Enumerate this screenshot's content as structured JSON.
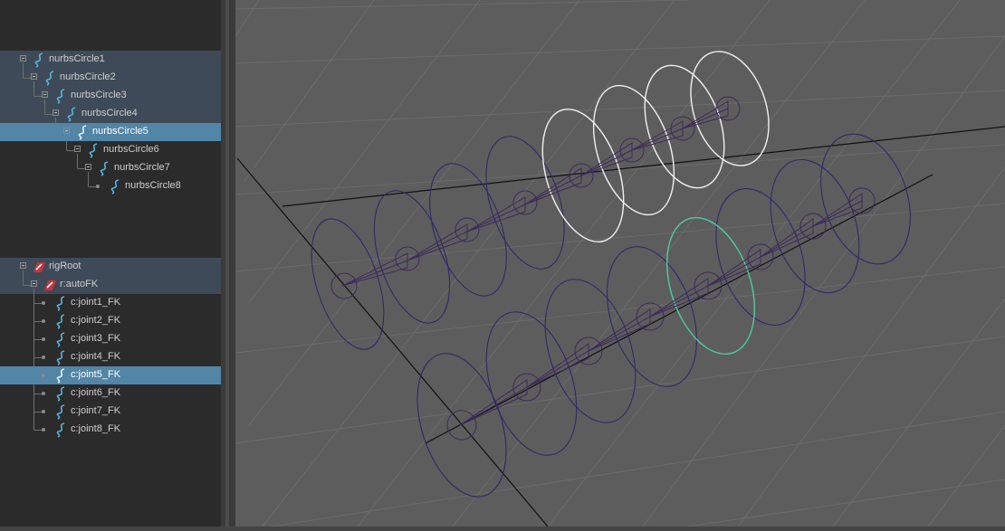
{
  "outliner": {
    "curves": [
      {
        "label": "nurbsCircle1",
        "selected": false
      },
      {
        "label": "nurbsCircle2",
        "selected": false
      },
      {
        "label": "nurbsCircle3",
        "selected": false
      },
      {
        "label": "nurbsCircle4",
        "selected": false
      },
      {
        "label": "nurbsCircle5",
        "selected": true
      },
      {
        "label": "nurbsCircle6",
        "selected": false
      },
      {
        "label": "nurbsCircle7",
        "selected": false
      },
      {
        "label": "nurbsCircle8",
        "selected": false
      }
    ],
    "rig": {
      "root": "rigRoot",
      "auto": "r:autoFK",
      "joints": [
        {
          "label": "c:joint1_FK",
          "selected": false
        },
        {
          "label": "c:joint2_FK",
          "selected": false
        },
        {
          "label": "c:joint3_FK",
          "selected": false
        },
        {
          "label": "c:joint4_FK",
          "selected": false
        },
        {
          "label": "c:joint5_FK",
          "selected": true
        },
        {
          "label": "c:joint6_FK",
          "selected": false
        },
        {
          "label": "c:joint7_FK",
          "selected": false
        },
        {
          "label": "c:joint8_FK",
          "selected": false
        }
      ]
    }
  },
  "colors": {
    "panel_bg": "#2b2b2b",
    "group_bg": "#3e4a57",
    "selection_bg": "#5285a6",
    "viewport_bg": "#5d5d5d",
    "grid": "#6b6b6b",
    "curve_icon": "#58b4e0",
    "rig_icon": "#c9323a",
    "control_circle": "#2e2a66",
    "selected_circle": "#f0f0f0",
    "lead_circle": "#52c9a1",
    "joint_lines": "#3c2a5a"
  },
  "icons": {
    "curve": "nurbs-curve-icon",
    "rig": "transform-icon",
    "expand": "collapse-box-icon",
    "leaf": "leaf-dot-icon"
  }
}
